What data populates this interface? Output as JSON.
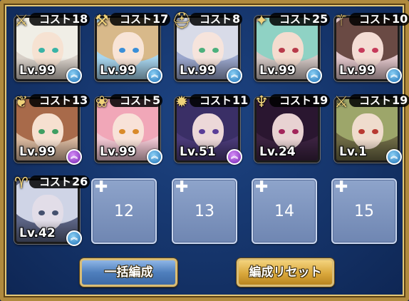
{
  "cost_label": "コスト",
  "units": [
    {
      "cost": "18",
      "level": "Lv.99",
      "weapon": "sword",
      "awaken": "blue",
      "hair": "#f0eee6",
      "skin": "#f6e2d2",
      "eye": "#39b3a6",
      "bg": "#d8d0c8"
    },
    {
      "cost": "17",
      "level": "Lv.99",
      "weapon": "hammer",
      "awaken": "blue",
      "hair": "#d8b98a",
      "skin": "#f8e4d6",
      "eye": "#3a8fd8",
      "bg": "#a7d5ee"
    },
    {
      "cost": "8",
      "level": "Lv.99",
      "weapon": "helmet",
      "awaken": "blue",
      "hair": "#d8dbe8",
      "skin": "#f6e4dc",
      "eye": "#4db07d",
      "bg": "#9aa6cc"
    },
    {
      "cost": "25",
      "level": "Lv.99",
      "weapon": "crest",
      "awaken": "blue",
      "hair": "#8fd2c4",
      "skin": "#f4dccf",
      "eye": "#b83a4a",
      "bg": "#d2c6c3"
    },
    {
      "cost": "10",
      "level": "Lv.99",
      "weapon": "staff",
      "awaken": "blue",
      "hair": "#6a4a44",
      "skin": "#f4dcd4",
      "eye": "#c63a5a",
      "bg": "#e0c4c8"
    },
    {
      "cost": "13",
      "level": "Lv.99",
      "weapon": "leaf",
      "awaken": "purple",
      "hair": "#a86a4a",
      "skin": "#f6e0d0",
      "eye": "#3f9e62",
      "bg": "#d9b89e"
    },
    {
      "cost": "5",
      "level": "Lv.99",
      "weapon": "shoes",
      "awaken": "blue",
      "hair": "#f1a7b8",
      "skin": "#f8e2d8",
      "eye": "#d98a2a",
      "bg": "#f0c6d2"
    },
    {
      "cost": "11",
      "level": "Lv.51",
      "weapon": "cannon",
      "awaken": "purple",
      "hair": "#3a2f66",
      "skin": "#ecd8d8",
      "eye": "#5a3e98",
      "bg": "#4a3a78"
    },
    {
      "cost": "19",
      "level": "Lv.24",
      "weapon": "horns",
      "awaken": "none",
      "hair": "#2a1630",
      "skin": "#e8d2d2",
      "eye": "#a2245a",
      "bg": "#3b2240"
    },
    {
      "cost": "19",
      "level": "Lv.1",
      "weapon": "blade",
      "awaken": "blue",
      "hair": "#9da66a",
      "skin": "#efdccd",
      "eye": "#b83a32",
      "bg": "#6e6a45"
    },
    {
      "cost": "26",
      "level": "Lv.42",
      "weapon": "ram",
      "awaken": "blue",
      "hair": "#cfd4e6",
      "skin": "#e2dde8",
      "eye": "#44506e",
      "bg": "#5c6484"
    }
  ],
  "empty_slots": [
    "12",
    "13",
    "14",
    "15"
  ],
  "buttons": {
    "bulk": "一括編成",
    "reset": "編成リセット"
  }
}
